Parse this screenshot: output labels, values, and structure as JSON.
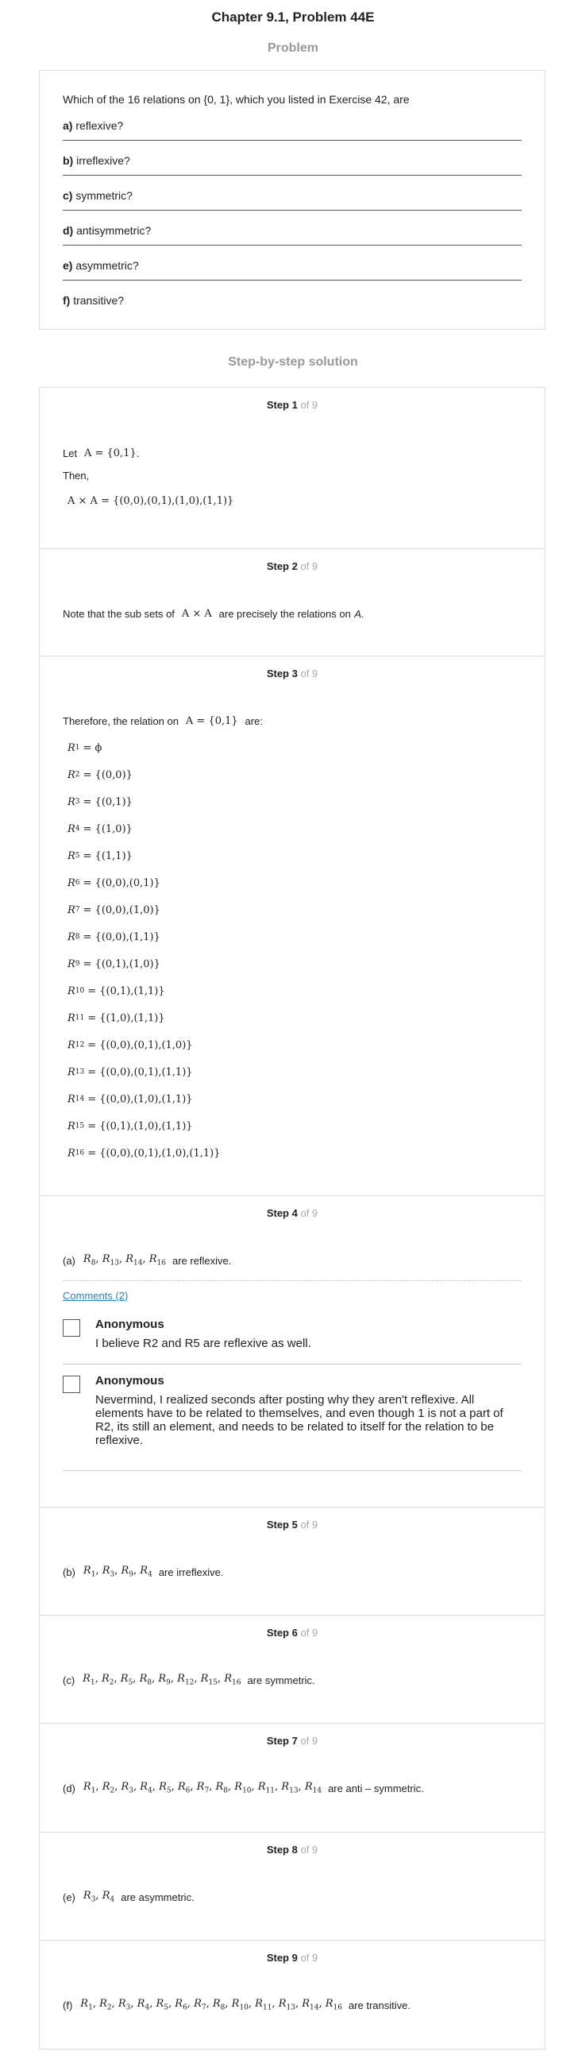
{
  "header": {
    "title": "Chapter 9.1, Problem 44E",
    "problem_label": "Problem"
  },
  "problem": {
    "intro": "Which of the 16 relations on {0, 1}, which you listed in Exercise 42, are",
    "parts": [
      {
        "letter": "a)",
        "text": "reflexive?"
      },
      {
        "letter": "b)",
        "text": "irreflexive?"
      },
      {
        "letter": "c)",
        "text": "symmetric?"
      },
      {
        "letter": "d)",
        "text": "antisymmetric?"
      },
      {
        "letter": "e)",
        "text": "asymmetric?"
      },
      {
        "letter": "f)",
        "text": "transitive?"
      }
    ]
  },
  "solution_label": "Step-by-step solution",
  "steps": [
    {
      "label": "Step 1",
      "of": "of 9",
      "let_word": "Let",
      "let_math": "A = {0,1}",
      "let_end": ".",
      "then": "Then,",
      "product": "A × A = {(0,0),(0,1),(1,0),(1,1)}"
    },
    {
      "label": "Step 2",
      "of": "of 9",
      "pre": "Note that the sub sets of",
      "math": "A × A",
      "post": "are precisely the relations on",
      "end": "A."
    },
    {
      "label": "Step 3",
      "of": "of 9",
      "pre": "Therefore, the relation on",
      "math": "A = {0,1}",
      "post": "are:",
      "relations": [
        {
          "n": "1",
          "v": "= ϕ"
        },
        {
          "n": "2",
          "v": "= {(0,0)}"
        },
        {
          "n": "3",
          "v": "= {(0,1)}"
        },
        {
          "n": "4",
          "v": "= {(1,0)}"
        },
        {
          "n": "5",
          "v": "= {(1,1)}"
        },
        {
          "n": "6",
          "v": "= {(0,0),(0,1)}"
        },
        {
          "n": "7",
          "v": "= {(0,0),(1,0)}"
        },
        {
          "n": "8",
          "v": "= {(0,0),(1,1)}"
        },
        {
          "n": "9",
          "v": "= {(0,1),(1,0)}"
        },
        {
          "n": "10",
          "v": "= {(0,1),(1,1)}"
        },
        {
          "n": "11",
          "v": "= {(1,0),(1,1)}"
        },
        {
          "n": "12",
          "v": "= {(0,0),(0,1),(1,0)}"
        },
        {
          "n": "13",
          "v": "= {(0,0),(0,1),(1,1)}"
        },
        {
          "n": "14",
          "v": "= {(0,0),(1,0),(1,1)}"
        },
        {
          "n": "15",
          "v": "= {(0,1),(1,0),(1,1)}"
        },
        {
          "n": "16",
          "v": "= {(0,0),(0,1),(1,0),(1,1)}"
        }
      ]
    },
    {
      "label": "Step 4",
      "of": "of 9",
      "part": "(a)",
      "subs": [
        "8",
        "13",
        "14",
        "16"
      ],
      "post": "are reflexive."
    },
    {
      "label": "Step 5",
      "of": "of 9",
      "part": "(b)",
      "subs": [
        "1",
        "3",
        "9",
        "4"
      ],
      "post": "are irreflexive."
    },
    {
      "label": "Step 6",
      "of": "of 9",
      "part": "(c)",
      "subs": [
        "1",
        "2",
        "5",
        "8",
        "9",
        "12",
        "15",
        "16"
      ],
      "post": "are symmetric."
    },
    {
      "label": "Step 7",
      "of": "of 9",
      "part": "(d)",
      "subs": [
        "1",
        "2",
        "3",
        "4",
        "5",
        "6",
        "7",
        "8",
        "10",
        "11",
        "13",
        "14"
      ],
      "post": "are anti – symmetric."
    },
    {
      "label": "Step 8",
      "of": "of 9",
      "part": "(e)",
      "subs": [
        "3",
        "4"
      ],
      "post": "are asymmetric."
    },
    {
      "label": "Step 9",
      "of": "of 9",
      "part": "(f)",
      "subs": [
        "1",
        "2",
        "3",
        "4",
        "5",
        "6",
        "7",
        "8",
        "10",
        "11",
        "13",
        "14",
        "16"
      ],
      "post": "are transitive."
    }
  ],
  "comments": {
    "link": "Comments (2)",
    "items": [
      {
        "author": "Anonymous",
        "text": "I believe R2 and R5 are reflexive as well."
      },
      {
        "author": "Anonymous",
        "text": "Nevermind, I realized seconds after posting why they aren't reflexive. All elements have to be related to themselves, and even though 1 is not a part of R2, its still an element, and needs to be related to itself for the relation to be reflexive."
      }
    ]
  }
}
